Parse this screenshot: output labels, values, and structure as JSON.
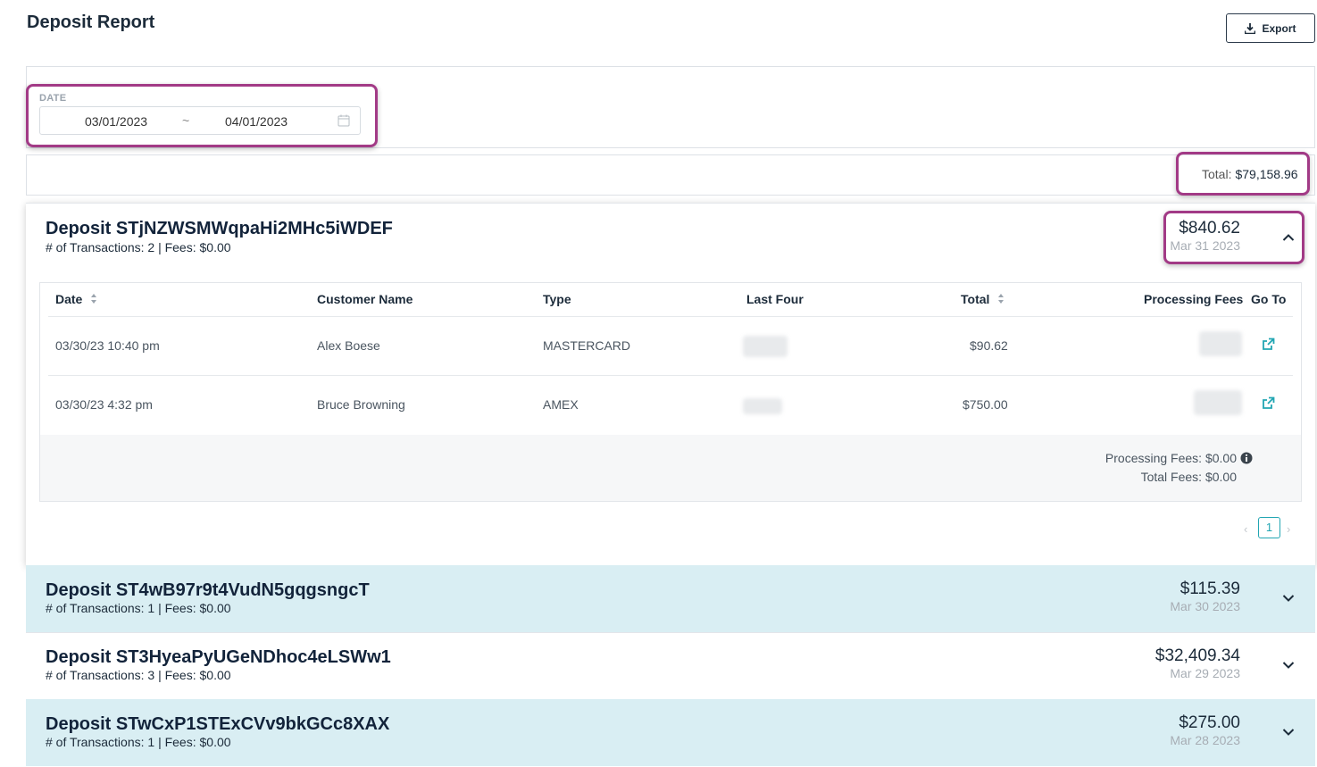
{
  "header": {
    "title": "Deposit Report",
    "export_label": "Export"
  },
  "filter": {
    "date_label": "DATE",
    "date_from": "03/01/2023",
    "date_separator": "~",
    "date_to": "04/01/2023"
  },
  "summary": {
    "total_label": "Total:",
    "total_value": "$79,158.96"
  },
  "open_deposit": {
    "title": "Deposit STjNZWSMWqpaHi2MHc5iWDEF",
    "subtitle": "# of Transactions: 2 | Fees: $0.00",
    "amount": "$840.62",
    "date": "Mar 31 2023",
    "columns": {
      "date": "Date",
      "customer": "Customer Name",
      "type": "Type",
      "last_four": "Last Four",
      "total": "Total",
      "fees": "Processing Fees",
      "goto": "Go To"
    },
    "rows": [
      {
        "date": "03/30/23 10:40 pm",
        "customer": "Alex Boese",
        "type": "MASTERCARD",
        "total": "$90.62"
      },
      {
        "date": "03/30/23 4:32 pm",
        "customer": "Bruce Browning",
        "type": "AMEX",
        "total": "$750.00"
      }
    ],
    "processing_fees": "Processing Fees: $0.00",
    "total_fees": "Total Fees: $0.00",
    "pagination": {
      "prev": "‹",
      "page": "1",
      "next": "›"
    }
  },
  "deposits": [
    {
      "title": "Deposit ST4wB97r9t4VudN5gqgsngcT",
      "subtitle": "# of Transactions: 1 | Fees: $0.00",
      "amount": "$115.39",
      "date": "Mar 30 2023"
    },
    {
      "title": "Deposit ST3HyeaPyUGeNDhoc4eLSWw1",
      "subtitle": "# of Transactions: 3 | Fees: $0.00",
      "amount": "$32,409.34",
      "date": "Mar 29 2023"
    },
    {
      "title": "Deposit STwCxP1STExCVv9bkGCc8XAX",
      "subtitle": "# of Transactions: 1 | Fees: $0.00",
      "amount": "$275.00",
      "date": "Mar 28 2023"
    }
  ],
  "colors": {
    "highlight": "#a23a86",
    "accent": "#22a6b3",
    "row_tint": "#d9eef3"
  }
}
